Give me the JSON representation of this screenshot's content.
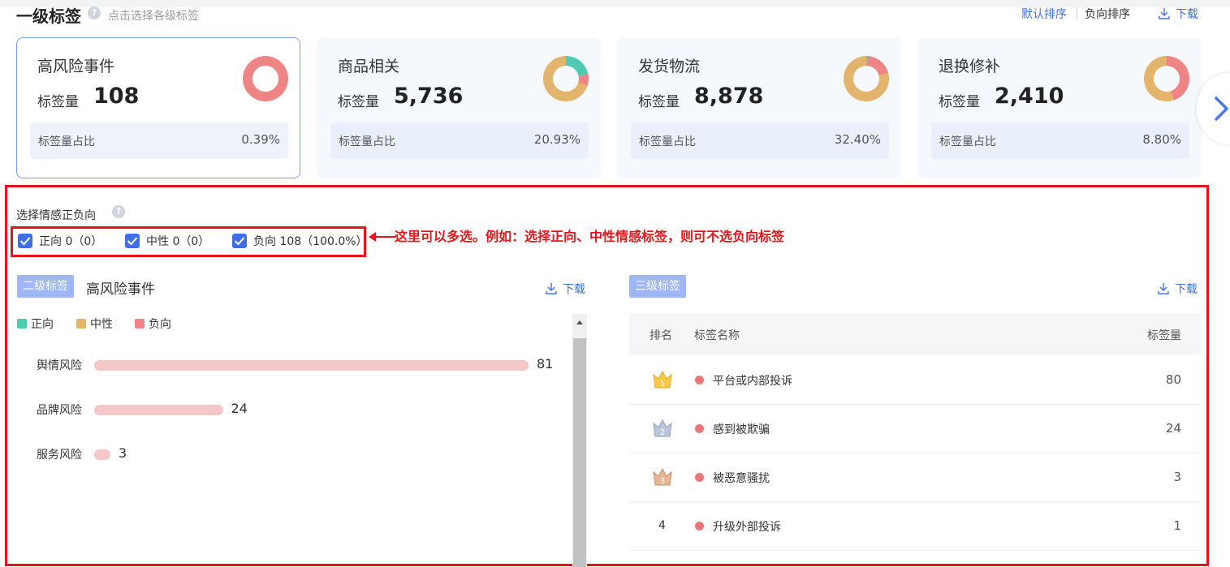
{
  "header": {
    "title": "一级标签",
    "hint": "点击选择各级标签",
    "sort_default": "默认排序",
    "sort_negative": "负向排序",
    "download": "下载"
  },
  "cards": [
    {
      "name": "高风险事件",
      "count_label": "标签量",
      "count": "108",
      "ratio_label": "标签量占比",
      "ratio": "0.39%",
      "donut": {
        "positive": 0,
        "neutral": 0,
        "negative": 108
      }
    },
    {
      "name": "商品相关",
      "count_label": "标签量",
      "count": "5,736",
      "ratio_label": "标签量占比",
      "ratio": "20.93%",
      "donut": {
        "positive": 0.22,
        "neutral": 0.7,
        "negative": 0.08
      }
    },
    {
      "name": "发货物流",
      "count_label": "标签量",
      "count": "8,878",
      "ratio_label": "标签量占比",
      "ratio": "32.40%",
      "donut": {
        "positive": 0.01,
        "neutral": 0.79,
        "negative": 0.2
      }
    },
    {
      "name": "退换修补",
      "count_label": "标签量",
      "count": "2,410",
      "ratio_label": "标签量占比",
      "ratio": "8.80%",
      "donut": {
        "positive": 0.0,
        "neutral": 0.55,
        "negative": 0.45
      }
    }
  ],
  "sentiment": {
    "title": "选择情感正负向",
    "options": [
      {
        "label": "正向 0（0）",
        "checked": true
      },
      {
        "label": "中性 0（0）",
        "checked": true
      },
      {
        "label": "负向 108（100.0%）",
        "checked": true
      }
    ],
    "annotation": "这里可以多选。例如：选择正向、中性情感标签，则可不选负向标签"
  },
  "level2": {
    "pill": "二级标签",
    "name": "高风险事件",
    "download": "下载",
    "legend": [
      {
        "label": "正向",
        "color": "#4ecbb0"
      },
      {
        "label": "中性",
        "color": "#e3b46b"
      },
      {
        "label": "负向",
        "color": "#ef8485"
      }
    ]
  },
  "chart_data": {
    "type": "bar",
    "orientation": "horizontal",
    "categories": [
      "舆情风险",
      "品牌风险",
      "服务风险"
    ],
    "series": [
      {
        "name": "负向",
        "values": [
          81,
          24,
          3
        ],
        "color": "#f5c7c8"
      }
    ],
    "xlim": [
      0,
      81
    ]
  },
  "level3": {
    "pill": "三级标签",
    "download": "下载",
    "columns": {
      "rank": "排名",
      "name": "标签名称",
      "count": "标签量"
    },
    "rows": [
      {
        "rank": "1",
        "name": "平台或内部投诉",
        "count": "80",
        "crown": "gold"
      },
      {
        "rank": "2",
        "name": "感到被欺骗",
        "count": "24",
        "crown": "silver"
      },
      {
        "rank": "3",
        "name": "被恶意骚扰",
        "count": "3",
        "crown": "bronze"
      },
      {
        "rank": "4",
        "name": "升级外部投诉",
        "count": "1",
        "crown": ""
      }
    ]
  },
  "colors": {
    "accent": "#3f72e8",
    "positive": "#4ecbb0",
    "neutral": "#e3b46b",
    "negative": "#ef8485",
    "annotation_red": "#e8141b"
  }
}
